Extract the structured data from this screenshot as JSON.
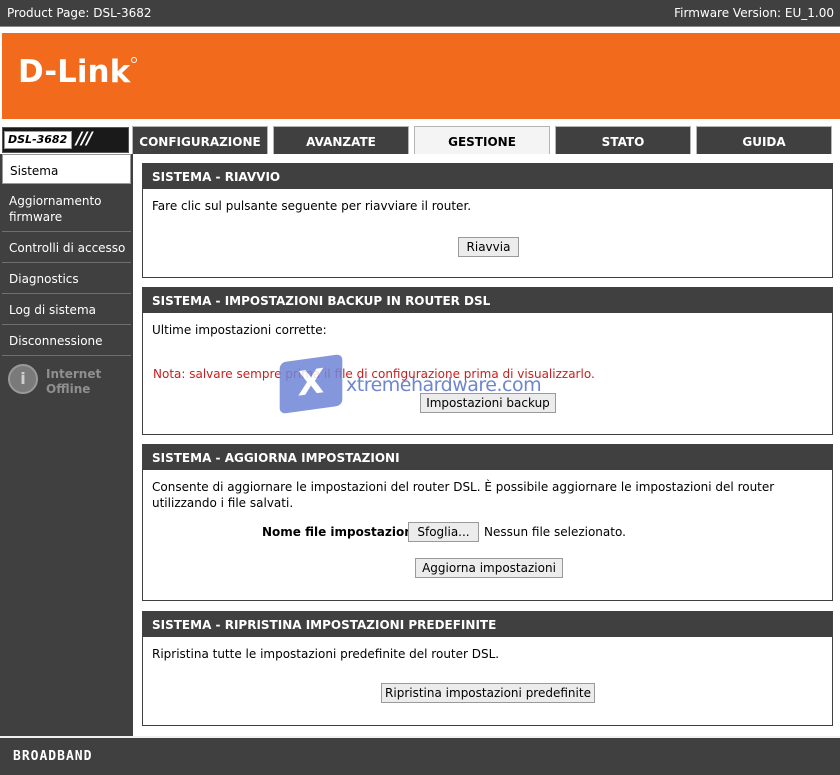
{
  "topbar": {
    "product": "Product Page: DSL-3682",
    "firmware": "Firmware Version: EU_1.00"
  },
  "brand": {
    "logo": "D-Link",
    "model": "DSL-3682",
    "slashes": "///",
    "color": "#f26a1c",
    "footer": "BROADBAND"
  },
  "tabs": [
    {
      "label": "CONFIGURAZIONE",
      "active": false
    },
    {
      "label": "AVANZATE",
      "active": false
    },
    {
      "label": "GESTIONE",
      "active": true
    },
    {
      "label": "STATO",
      "active": false
    },
    {
      "label": "GUIDA",
      "active": false
    }
  ],
  "sidebar": {
    "items": [
      {
        "label": "Sistema",
        "active": true
      },
      {
        "label": "Aggiornamento firmware",
        "active": false
      },
      {
        "label": "Controlli di accesso",
        "active": false
      },
      {
        "label": "Diagnostics",
        "active": false
      },
      {
        "label": "Log di sistema",
        "active": false
      },
      {
        "label": "Disconnessione",
        "active": false
      }
    ],
    "status": {
      "icon": "info-icon",
      "line1": "Internet",
      "line2": "Offline"
    }
  },
  "sections": {
    "riavvio": {
      "title": "SISTEMA - RIAVVIO",
      "text": "Fare clic sul pulsante seguente per riavviare il router.",
      "button": "Riavvia"
    },
    "backup": {
      "title": "SISTEMA - IMPOSTAZIONI BACKUP IN ROUTER DSL",
      "text": "Ultime impostazioni corrette:",
      "note": "Nota: salvare sempre prima il file di configurazione prima di visualizzarlo.",
      "button": "Impostazioni backup"
    },
    "aggiorna": {
      "title": "SISTEMA - AGGIORNA IMPOSTAZIONI",
      "text": "Consente di aggiornare le impostazioni del router DSL. È possibile aggiornare le impostazioni del router utilizzando i file salvati.",
      "file_label": "Nome file impostazioni:",
      "browse_button": "Sfoglia...",
      "file_status": "Nessun file selezionato.",
      "button": "Aggiorna impostazioni"
    },
    "ripristina": {
      "title": "SISTEMA - RIPRISTINA IMPOSTAZIONI PREDEFINITE",
      "text": "Ripristina tutte le impostazioni predefinite del router DSL.",
      "button": "Ripristina impostazioni predefinite"
    }
  },
  "watermark": {
    "mark": "X",
    "text": "xtremehardware.com"
  }
}
